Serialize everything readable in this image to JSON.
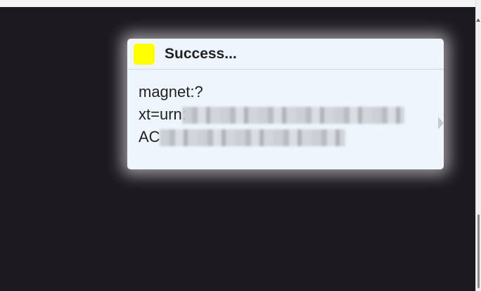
{
  "popup": {
    "title": "Success...",
    "status_color": "#ffff00",
    "lines": [
      "magnet:?",
      "xt=urn:",
      "AC"
    ],
    "line_endings": [
      "",
      "DC09",
      "CA5"
    ]
  }
}
